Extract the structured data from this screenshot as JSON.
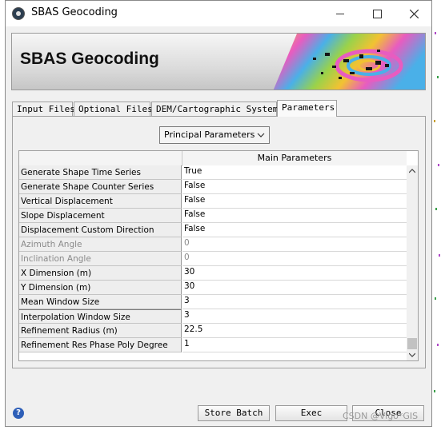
{
  "window": {
    "title": "SBAS Geocoding"
  },
  "banner": {
    "title": "SBAS Geocoding"
  },
  "tabs": [
    {
      "label": "Input Files",
      "active": false
    },
    {
      "label": "Optional Files",
      "active": false
    },
    {
      "label": "DEM/Cartographic System",
      "active": false
    },
    {
      "label": "Parameters",
      "active": true
    }
  ],
  "section_select": {
    "value": "Principal Parameters"
  },
  "table": {
    "column_header": "Main Parameters",
    "rows": [
      {
        "name": "Generate Shape Time Series",
        "value": "True",
        "enabled": true
      },
      {
        "name": "Generate Shape Counter Series",
        "value": "False",
        "enabled": true
      },
      {
        "name": "Vertical Displacement",
        "value": "False",
        "enabled": true
      },
      {
        "name": "Slope Displacement",
        "value": "False",
        "enabled": true
      },
      {
        "name": "Displacement Custom Direction",
        "value": "False",
        "enabled": true
      },
      {
        "name": "Azimuth Angle",
        "value": "0",
        "enabled": false
      },
      {
        "name": "Inclination Angle",
        "value": "0",
        "enabled": false
      },
      {
        "name": "X Dimension (m)",
        "value": "30",
        "enabled": true
      },
      {
        "name": "Y Dimension (m)",
        "value": "30",
        "enabled": true
      },
      {
        "name": "Mean Window Size",
        "value": "3",
        "enabled": true
      },
      {
        "name": "Interpolation Window Size",
        "value": "3",
        "enabled": true
      },
      {
        "name": "Refinement Radius (m)",
        "value": "22.5",
        "enabled": true
      },
      {
        "name": "Refinement Res Phase Poly Degree",
        "value": "1",
        "enabled": true
      }
    ]
  },
  "buttons": {
    "store_batch": "Store Batch",
    "exec": "Exec",
    "close": "Close"
  },
  "watermark": "CSDN @Vigo*GIS",
  "icons": {
    "help": "help-icon",
    "app": "app-icon"
  },
  "colors": {
    "window_bg": "#f0f0f0",
    "disabled_text": "#8a8a8a",
    "help_icon": "#2e5fb8"
  }
}
